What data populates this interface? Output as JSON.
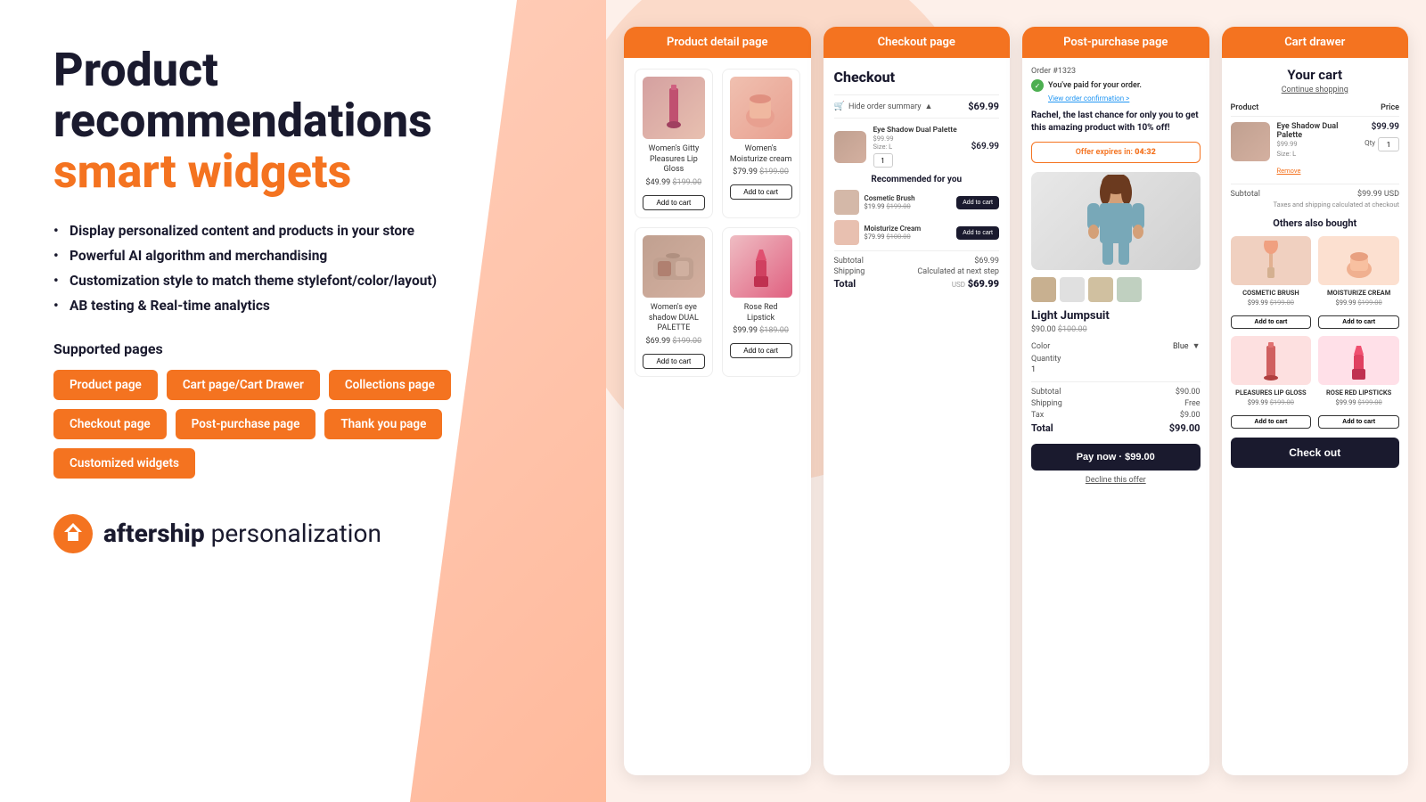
{
  "left": {
    "title_line1": "Product",
    "title_line2": "recommendations",
    "title_line3": "smart widgets",
    "features": [
      "Display personalized content and products in your store",
      "Powerful AI algorithm and merchandising",
      "Customization style to match theme stylefont/color/layout)",
      "AB testing & Real-time analytics"
    ],
    "supported_pages_label": "Supported pages",
    "badges": [
      "Product page",
      "Cart page/Cart Drawer",
      "Collections page",
      "Checkout page",
      "Post-purchase page",
      "Thank you page",
      "Customized widgets"
    ],
    "logo_name": "aftership",
    "logo_tagline": "personalization"
  },
  "panel1": {
    "header": "Product detail page",
    "products": [
      {
        "name": "Women's Gitty Pleasures Lip Gloss",
        "price": "$49.99",
        "old_price": "$199.00",
        "btn": "Add to cart"
      },
      {
        "name": "Women's Moisturize cream",
        "price": "$79.99",
        "old_price": "$199.00",
        "btn": "Add to cart"
      },
      {
        "name": "Women's eye shadow DUAL PALETTE",
        "price": "$69.99",
        "old_price": "$199.00",
        "btn": "Add to cart"
      },
      {
        "name": "Rose Red Lipstick",
        "price": "$99.99",
        "old_price": "$189.00",
        "btn": "Add to cart"
      }
    ]
  },
  "panel2": {
    "header": "Checkout page",
    "title": "Checkout",
    "order_summary_label": "Hide order summary",
    "order_summary_price": "$69.99",
    "order_item": {
      "name": "Eye Shadow Dual Palette",
      "sub": "$99.99\nSize: L",
      "price": "$69.99",
      "qty": "1"
    },
    "recommended_title": "Recommended for you",
    "rec_items": [
      {
        "name": "Cosmetic Brush",
        "price": "$19.99",
        "old_price": "$199.00",
        "btn": "Add to cart"
      },
      {
        "name": "Moisturize Cream",
        "price": "$79.99",
        "old_price": "$100.00",
        "btn": "Add to cart"
      }
    ],
    "subtotal_label": "Subtotal",
    "subtotal_value": "$69.99",
    "shipping_label": "Shipping",
    "shipping_value": "Calculated at next step",
    "total_label": "Total",
    "total_usd": "USD",
    "total_value": "$69.99"
  },
  "panel3": {
    "header": "Post-purchase page",
    "order_num": "Order #1323",
    "paid_text": "You've paid for your order.",
    "view_order": "View order confirmation >",
    "last_chance_text": "Rachel, the last chance for only you to get this amazing product with 10% off!",
    "offer_timer_label": "Offer expires in:",
    "offer_timer_value": "04:32",
    "product_name": "Light Jumpsuit",
    "product_price": "$90.00",
    "product_old_price": "$100.00",
    "color_label": "Color",
    "color_value": "Blue",
    "qty_label": "Quantity",
    "qty_value": "1",
    "subtotal_label": "Subtotal",
    "subtotal_value": "$90.00",
    "shipping_label": "Shipping",
    "shipping_value": "Free",
    "tax_label": "Tax",
    "tax_value": "$9.00",
    "total_label": "Total",
    "total_value": "$99.00",
    "pay_now_btn": "Pay now · $99.00",
    "decline_link": "Decline this offer"
  },
  "panel4": {
    "header": "Cart drawer",
    "title": "Your cart",
    "continue_shopping": "Continue shopping",
    "col_product": "Product",
    "col_price": "Price",
    "cart_item": {
      "name": "Eye Shadow Dual Palette",
      "price": "$99.99",
      "sub_price": "$99.99",
      "size": "Size: L",
      "remove": "Remove",
      "qty": "1"
    },
    "subtotal_label": "Subtotal",
    "subtotal_value": "$99.99 USD",
    "taxes_note": "Taxes and shipping calculated at checkout",
    "others_also_bought": "Others also bought",
    "also_bought_items": [
      {
        "name": "COSMETIC BRUSH",
        "price": "$99.99",
        "old_price": "$199.00",
        "btn": "Add to cart"
      },
      {
        "name": "MOISTURIZE CREAM",
        "price": "$99.99",
        "old_price": "$199.00",
        "btn": "Add to cart"
      },
      {
        "name": "PLEASURES LIP GLOSS",
        "price": "$99.99",
        "old_price": "$199.00",
        "btn": "Add to cart"
      },
      {
        "name": "ROSE RED LIPSTICKS",
        "price": "$99.99",
        "old_price": "$199.00",
        "btn": "Add to cart"
      }
    ],
    "checkout_btn": "Check out"
  }
}
